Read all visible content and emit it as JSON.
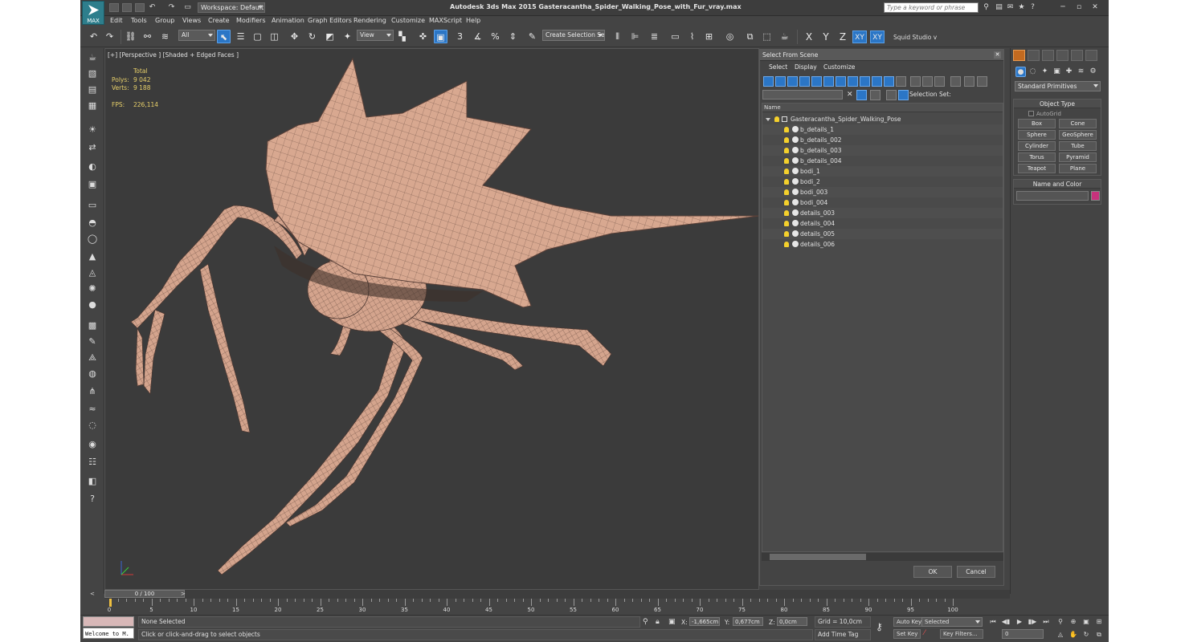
{
  "titlebar": {
    "workspace": "Workspace: Default",
    "app_title": "Autodesk 3ds Max  2015    Gasteracantha_Spider_Walking_Pose_with_Fur_vray.max",
    "help_placeholder": "Type a keyword or phrase",
    "logo": "MAX"
  },
  "menu": [
    "Edit",
    "Tools",
    "Group",
    "Views",
    "Create",
    "Modifiers",
    "Animation",
    "Graph Editors",
    "Rendering",
    "Customize",
    "MAXScript",
    "Help"
  ],
  "toolbar": {
    "filter": "All",
    "ref_coord": "View",
    "snap_angle": "3",
    "selection_set_placeholder": "Create Selection Se",
    "axis_x": "X",
    "axis_y": "Y",
    "axis_z": "Z",
    "axis_xy": "XY",
    "axis_xy2": "XY",
    "squid": "Squid Studio v"
  },
  "viewport": {
    "label": "[+] [Perspective ] [Shaded + Edged Faces ]",
    "stats_total": "Total",
    "polys_label": "Polys:",
    "polys_value": "9 042",
    "verts_label": "Verts:",
    "verts_value": "9 188",
    "fps_label": "FPS:",
    "fps_value": "226,114"
  },
  "dialog": {
    "title": "Select From Scene",
    "menu": [
      "Select",
      "Display",
      "Customize"
    ],
    "selection_set_label": "Selection Set:",
    "column_name": "Name",
    "root": "Gasteracantha_Spider_Walking_Pose",
    "items": [
      "b_details_1",
      "b_details_002",
      "b_details_003",
      "b_details_004",
      "bodi_1",
      "bodi_2",
      "bodi_003",
      "bodi_004",
      "details_003",
      "details_004",
      "details_005",
      "details_006"
    ],
    "ok": "OK",
    "cancel": "Cancel"
  },
  "cmdpanel": {
    "dropdown": "Standard Primitives",
    "object_type": "Object Type",
    "autogrid": "AutoGrid",
    "primitives": [
      "Box",
      "Cone",
      "Sphere",
      "GeoSphere",
      "Cylinder",
      "Tube",
      "Torus",
      "Pyramid",
      "Teapot",
      "Plane"
    ],
    "name_and_color": "Name and Color",
    "color": "#c8327c"
  },
  "timeline": {
    "slider": "0 / 100",
    "ticks": [
      "0",
      "5",
      "10",
      "15",
      "20",
      "25",
      "30",
      "35",
      "40",
      "45",
      "50",
      "55",
      "60",
      "65",
      "70",
      "75",
      "80",
      "85",
      "90",
      "95",
      "100"
    ]
  },
  "status": {
    "maxscript": "Welcome to M.",
    "selection": "None Selected",
    "prompt": "Click or click-and-drag to select objects",
    "x_label": "X:",
    "x_value": "-1,665cm",
    "y_label": "Y:",
    "y_value": "0,677cm",
    "z_label": "Z:",
    "z_value": "0,0cm",
    "grid": "Grid = 10,0cm",
    "add_time_tag": "Add Time Tag",
    "auto_key": "Auto Key",
    "set_key": "Set Key",
    "key_mode": "Selected",
    "key_filters": "Key Filters...",
    "frame": "0"
  },
  "colors": {
    "accent_blue": "#2b76c6",
    "spider": "#d8a890",
    "viewport_bg": "#3b3b3b"
  }
}
